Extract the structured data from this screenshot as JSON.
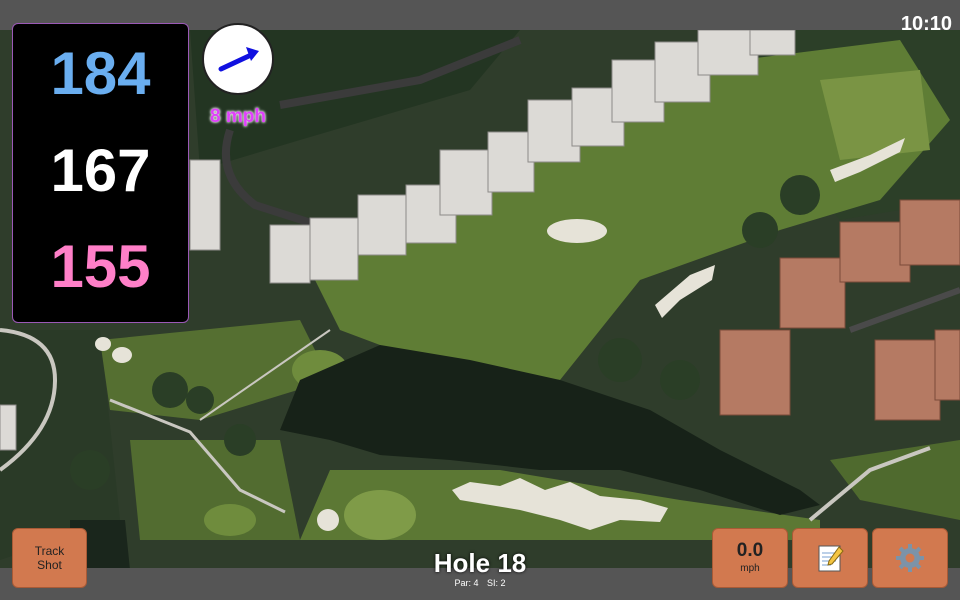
{
  "status": {
    "time": "10:10"
  },
  "distances": {
    "back": "184",
    "middle": "167",
    "front": "155"
  },
  "wind": {
    "speed": "8 mph",
    "icon": "wind-arrow-icon"
  },
  "track_shot": {
    "line1": "Track",
    "line2": "Shot"
  },
  "hole": {
    "title": "Hole 18",
    "par": "Par: 4",
    "si": "SI: 2"
  },
  "speed": {
    "value": "0.0",
    "unit": "mph"
  },
  "icons": {
    "notes": "notepad-icon",
    "settings": "gear-icon"
  },
  "colors": {
    "back": "#6aaef0",
    "middle": "#ffffff",
    "front": "#ff7fc8",
    "wind_text": "#e040fb",
    "button": "#d2794f",
    "arrow": "#1010e0"
  }
}
